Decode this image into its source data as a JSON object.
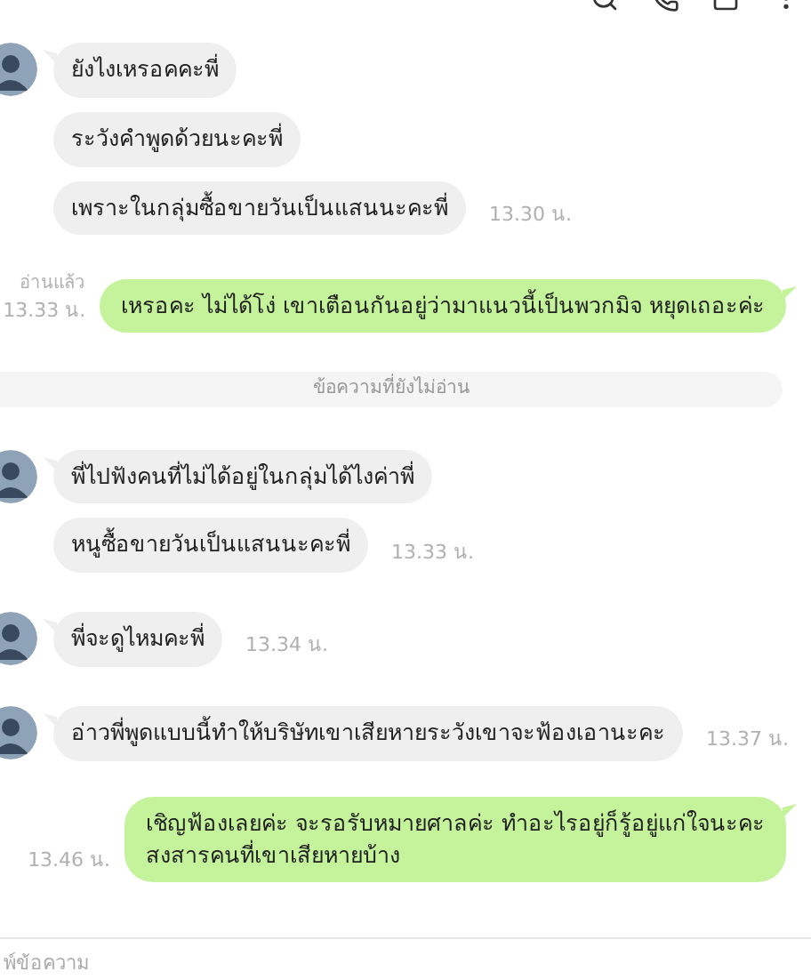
{
  "messages": [
    {
      "kind": "incoming",
      "bubbles": [
        "ยังไงเหรอคคะพี่",
        "ระวังคำพูดด้วยนะคะพี่",
        "เพราะในกลุ่มซื้อขายวันเป็นแสนนะคะพี่"
      ],
      "time": "13.30 น."
    },
    {
      "kind": "outgoing",
      "read": "อ่านแล้ว",
      "time": "13.33 น.",
      "lines": [
        "เหรอคะ ไม่ได้โง่ เขาเตือนกันอยู่ว่ามาแนวนี้เป็นพวกมิจ หยุดเถอะค่ะ"
      ]
    },
    {
      "kind": "divider",
      "text": "ข้อความที่ยังไม่อ่าน"
    },
    {
      "kind": "incoming",
      "bubbles": [
        "พี่ไปฟังคนที่ไม่ได้อยู่ในกลุ่มได้ไงค่าพี่",
        "หนูซื้อขายวันเป็นแสนนะคะพี่"
      ],
      "time": "13.33 น."
    },
    {
      "kind": "incoming",
      "bubbles": [
        "พี่จะดูไหมคะพี่"
      ],
      "time": "13.34 น."
    },
    {
      "kind": "incoming",
      "bubbles": [
        "อ่าวพี่พูดแบบนี้ทำให้บริษัทเขาเสียหายระวังเขาจะฟ้องเอานะคะ"
      ],
      "time": "13.37 น."
    },
    {
      "kind": "outgoing",
      "time": "13.46 น.",
      "lines": [
        "เชิญฟ้องเลยค่ะ จะรอรับหมายศาลค่ะ ทำอะไรอยู่ก็รู้อยู่แก่ใจนะคะ",
        "สงสารคนที่เขาเสียหายบ้าง"
      ]
    }
  ],
  "composer": {
    "placeholder": "พ์ข้อความ"
  }
}
